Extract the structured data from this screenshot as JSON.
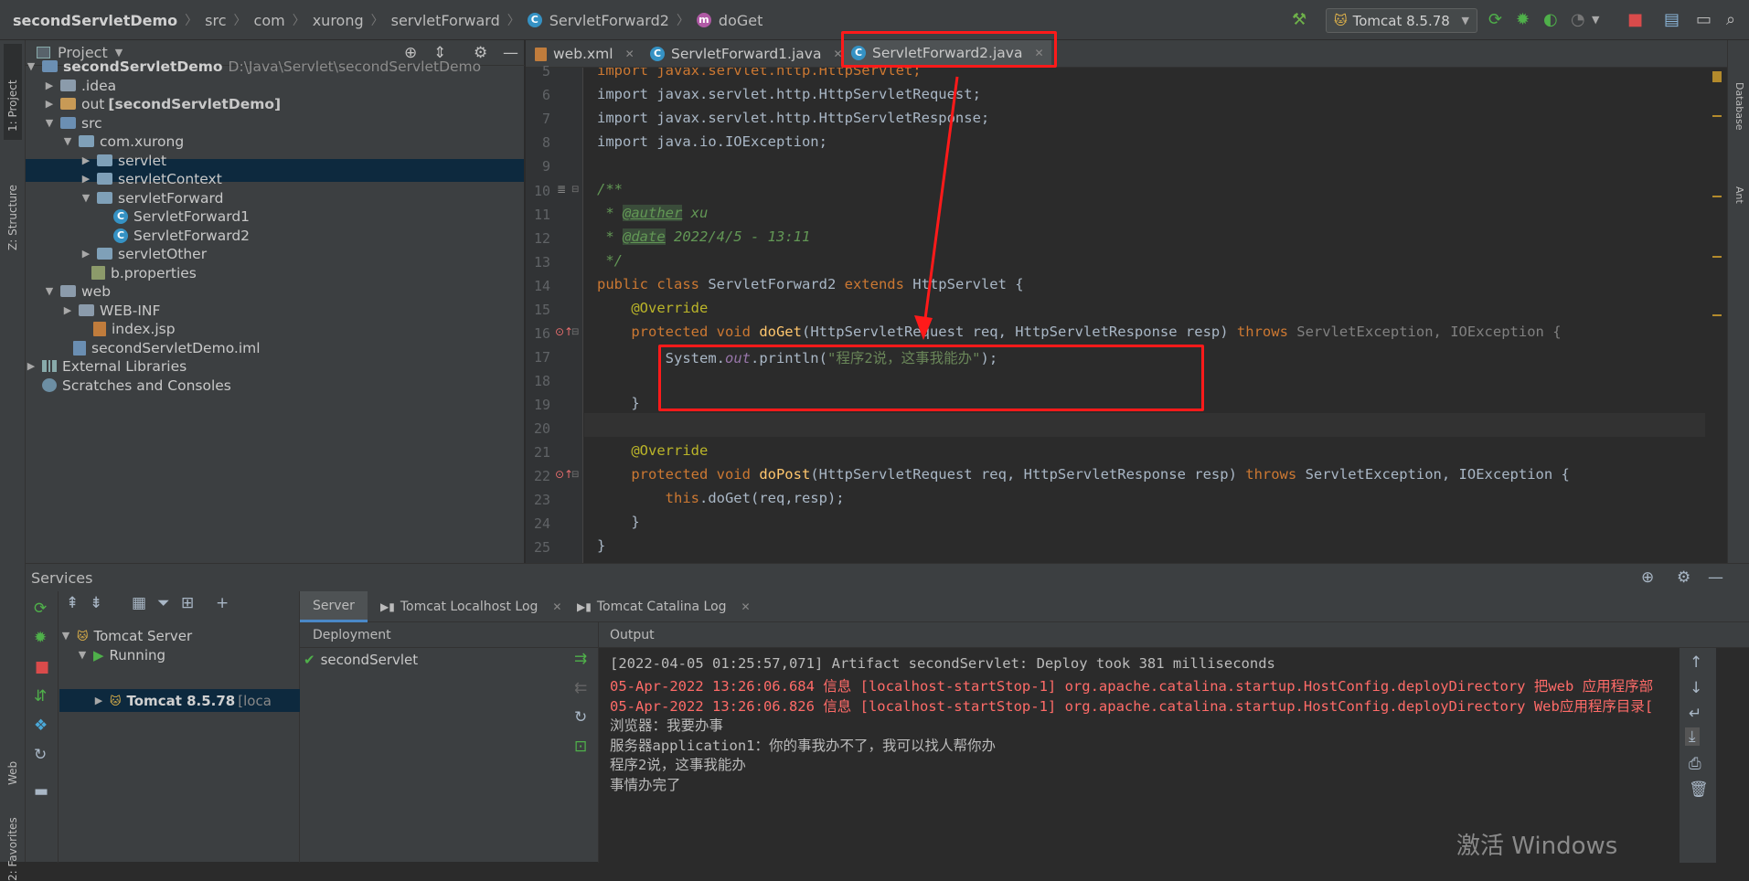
{
  "navbar": {
    "breadcrumbs": [
      "secondServletDemo",
      "src",
      "com",
      "xurong",
      "servletForward",
      "ServletForward2",
      "doGet"
    ],
    "class_badge": "C",
    "method_badge": "m",
    "run_config": "Tomcat 8.5.78"
  },
  "left_stripe": {
    "project": "1: Project",
    "structure": "Z: Structure",
    "web": "Web",
    "favorites": "2: Favorites"
  },
  "right_stripe": {
    "database": "Database",
    "ant": "Ant"
  },
  "project_panel": {
    "title": "Project",
    "root_name": "secondServletDemo",
    "root_path": "D:\\Java\\Servlet\\secondServletDemo",
    "items": {
      "idea": ".idea",
      "out": "out",
      "out_tag": "[secondServletDemo]",
      "src": "src",
      "pkg": "com.xurong",
      "servlet": "servlet",
      "servletContext": "servletContext",
      "servletForward": "servletForward",
      "sf1": "ServletForward1",
      "sf2": "ServletForward2",
      "servletOther": "servletOther",
      "props": "b.properties",
      "web": "web",
      "webinf": "WEB-INF",
      "index": "index.jsp",
      "iml": "secondServletDemo.iml",
      "extlib": "External Libraries",
      "scratches": "Scratches and Consoles"
    }
  },
  "editor": {
    "tabs": [
      "web.xml",
      "ServletForward1.java",
      "ServletForward2.java"
    ],
    "line_numbers": [
      "5",
      "6",
      "7",
      "8",
      "9",
      "10",
      "11",
      "12",
      "13",
      "14",
      "15",
      "16",
      "17",
      "18",
      "19",
      "20",
      "21",
      "22",
      "23",
      "24",
      "25"
    ],
    "code": {
      "l5": "import javax.servlet.http.HttpServlet;",
      "l6": "import javax.servlet.http.HttpServletRequest;",
      "l7": "import javax.servlet.http.HttpServletResponse;",
      "l8": "import java.io.IOException;",
      "l10": "/**",
      "l11_star": " * ",
      "l11_tag": "@auther",
      "l11_val": " xu",
      "l12_star": " * ",
      "l12_tag": "@date",
      "l12_val": " 2022/4/5 - 13:11",
      "l13": " */",
      "l14_a": "public class ",
      "l14_b": "ServletForward2 ",
      "l14_c": "extends ",
      "l14_d": "HttpServlet {",
      "l15": "    @Override",
      "l16_a": "    protected void ",
      "l16_b": "doGet",
      "l16_c": "(HttpServletRequest req, HttpServletResponse resp) ",
      "l16_d": "throws ",
      "l16_e": "ServletException, IOException {",
      "l17_a": "        System.",
      "l17_b": "out",
      "l17_c": ".println(",
      "l17_d": "\"程序2说，这事我能办\"",
      "l17_e": ");",
      "l19": "    }",
      "l21": "    @Override",
      "l22_a": "    protected void ",
      "l22_b": "doPost",
      "l22_c": "(HttpServletRequest req, HttpServletResponse resp) ",
      "l22_d": "throws ",
      "l22_e": "ServletException, IOException {",
      "l23_a": "        this",
      "l23_b": ".doGet(req,resp);",
      "l24": "    }",
      "l25": "}"
    }
  },
  "services": {
    "title": "Services",
    "tree": {
      "server": "Tomcat Server",
      "running": "Running",
      "instance": "Tomcat 8.5.78",
      "instance_suffix": "[loca"
    },
    "tabs": [
      "Server",
      "Tomcat Localhost Log",
      "Tomcat Catalina Log"
    ],
    "deployment_header": "Deployment",
    "deployment_item": "secondServlet",
    "output_header": "Output",
    "output_lines": [
      "[2022-04-05 01:25:57,071] Artifact secondServlet: Deploy took 381 milliseconds",
      "05-Apr-2022 13:26:06.684 信息 [localhost-startStop-1] org.apache.catalina.startup.HostConfig.deployDirectory 把web 应用程序部",
      "05-Apr-2022 13:26:06.826 信息 [localhost-startStop-1] org.apache.catalina.startup.HostConfig.deployDirectory Web应用程序目录[",
      "浏览器：我要办事",
      "服务器application1：你的事我办不了，我可以找人帮你办",
      "程序2说，这事我能办",
      "事情办完了"
    ]
  },
  "watermark": "激活 Windows",
  "colors": {
    "annotation_red": "#ff1a1a",
    "selection": "#0d293e",
    "keyword": "#cc7832",
    "string": "#6a8759"
  }
}
